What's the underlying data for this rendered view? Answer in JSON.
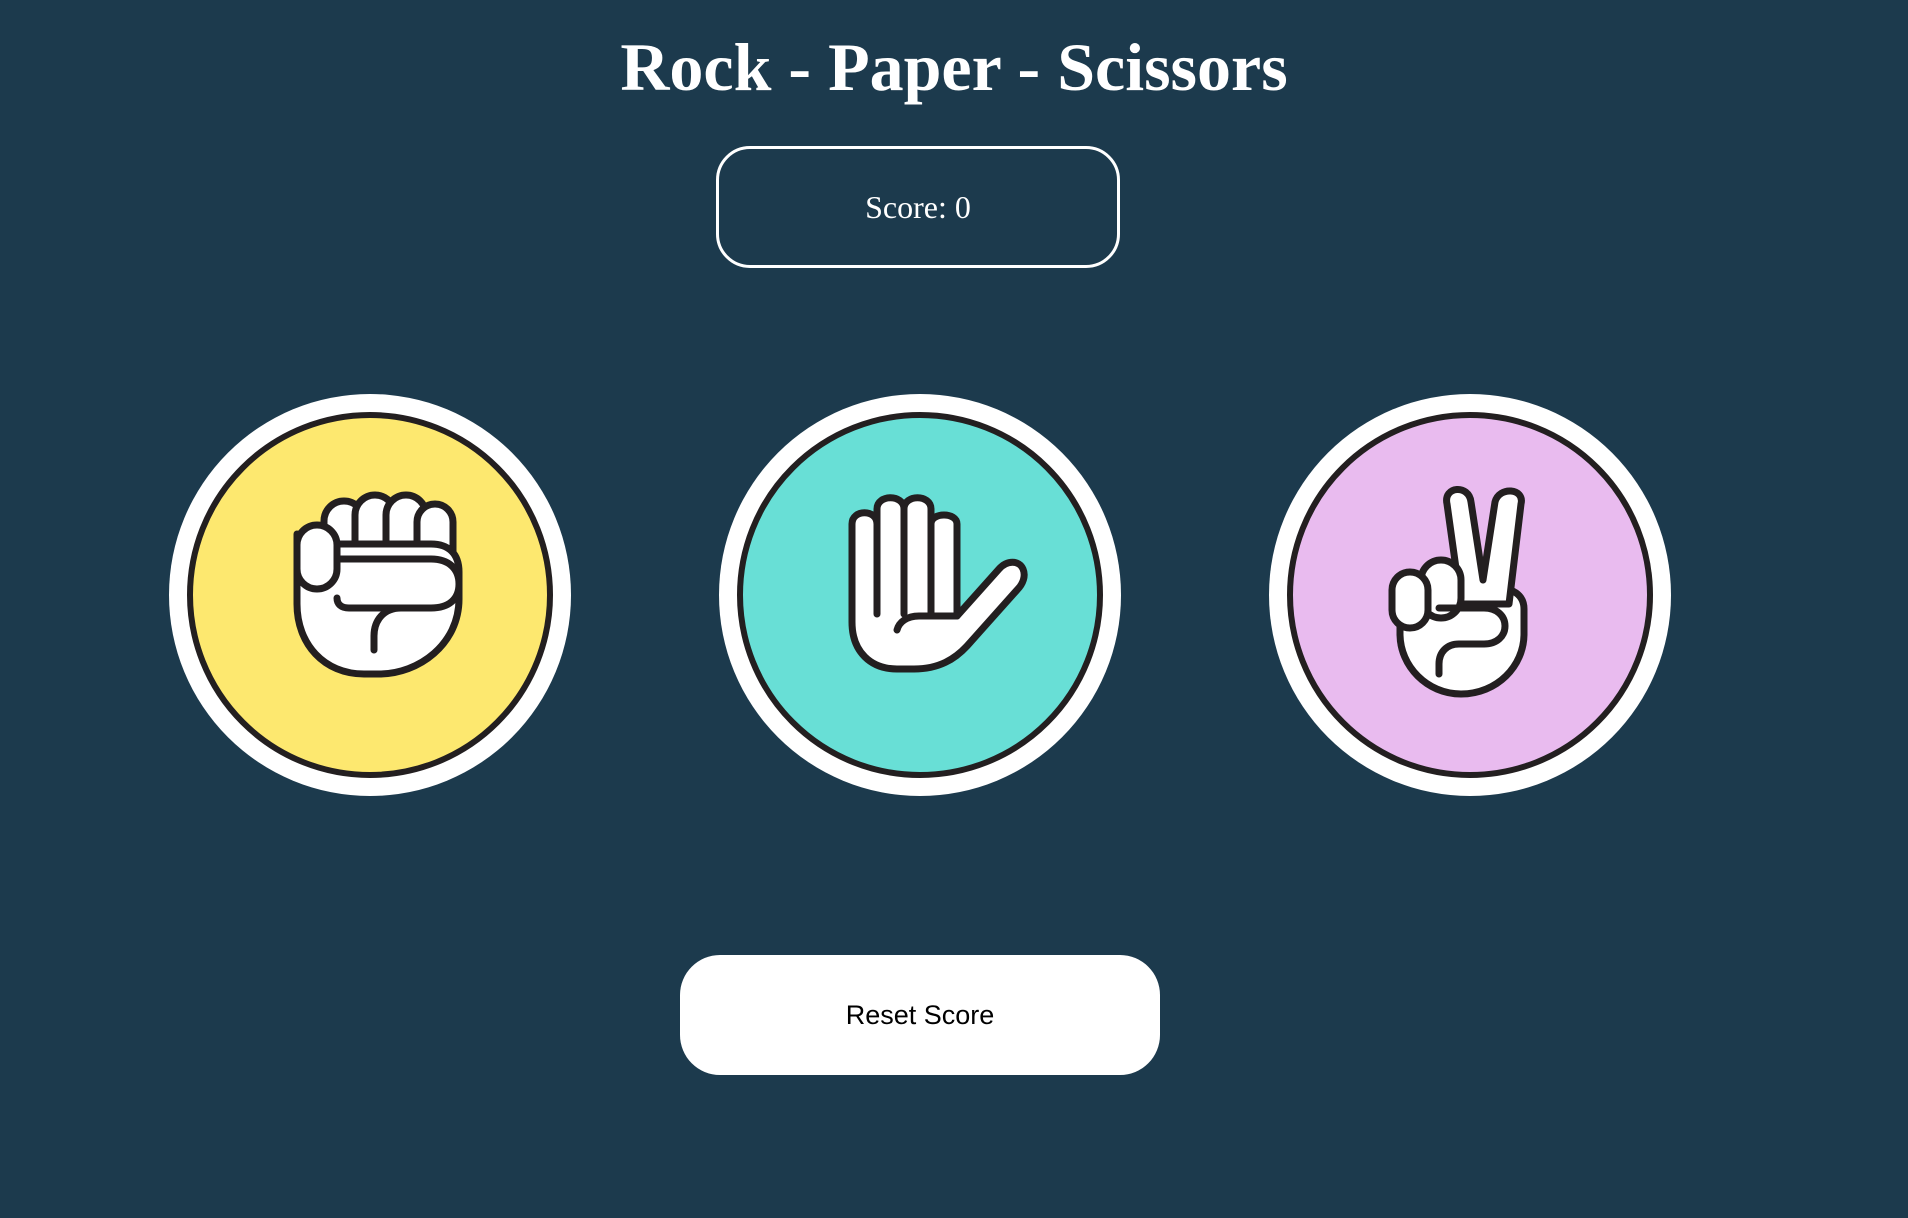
{
  "game": {
    "title": "Rock - Paper - Scissors",
    "score_text": "Score: 0",
    "reset_label": "Reset Score"
  },
  "choices": [
    {
      "name": "rock",
      "icon": "fist-icon",
      "color": "#fde86f"
    },
    {
      "name": "paper",
      "icon": "open-hand-icon",
      "color": "#68dfd6"
    },
    {
      "name": "scissors",
      "icon": "peace-hand-icon",
      "color": "#e9bbef"
    }
  ],
  "colors": {
    "background": "#1c3a4d",
    "outline": "#231f20",
    "text": "#ffffff"
  }
}
